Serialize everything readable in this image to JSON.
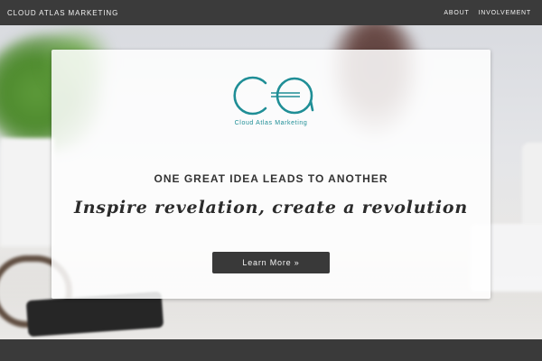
{
  "header": {
    "brand": "CLOUD ATLAS MARKETING",
    "nav": [
      {
        "label": "ABOUT"
      },
      {
        "label": "INVOLVEMENT"
      }
    ]
  },
  "hero": {
    "logo": {
      "monogram": "CA",
      "name": "Cloud Atlas Marketing",
      "color": "#1f8e96"
    },
    "tagline": "ONE GREAT IDEA LEADS TO ANOTHER",
    "headline": "Inspire revelation, create a revolution",
    "cta_label": "Learn More »"
  },
  "colors": {
    "topbar": "#3b3b3b",
    "button": "#393939",
    "accent": "#1f8e96"
  }
}
